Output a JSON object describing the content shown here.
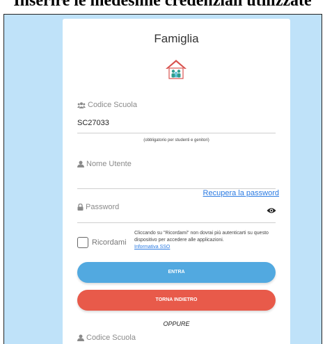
{
  "doc_heading": "Inserire le medesime credenziali utilizzate",
  "login": {
    "title": "Famiglia",
    "logo_icon": "family-house-icon",
    "school_code": {
      "label": "Codice Scuola",
      "value": "SC27033",
      "hint": "(obbligatorio per studenti e genitori)"
    },
    "username": {
      "label": "Nome Utente",
      "value": ""
    },
    "password": {
      "label": "Password",
      "value": "",
      "recover_link": "Recupera la password",
      "toggle_icon": "eye-icon"
    },
    "remember": {
      "label": "Ricordami",
      "checked": false,
      "note": "Cliccando su \"Ricordami\" non dovrai più autenticarti su questo dispositivo per accedere alle applicazioni.",
      "sso_link": "Informativa SSO"
    },
    "login_button": "ENTRA",
    "back_button": "TORNA INDIETRO",
    "or_text": "OPPURE",
    "second_school_code_label": "Codice Scuola"
  },
  "colors": {
    "background": "#bfe2f9",
    "login_button": "#52a9e0",
    "back_button": "#e85a4a",
    "link": "#2a7ae2"
  }
}
